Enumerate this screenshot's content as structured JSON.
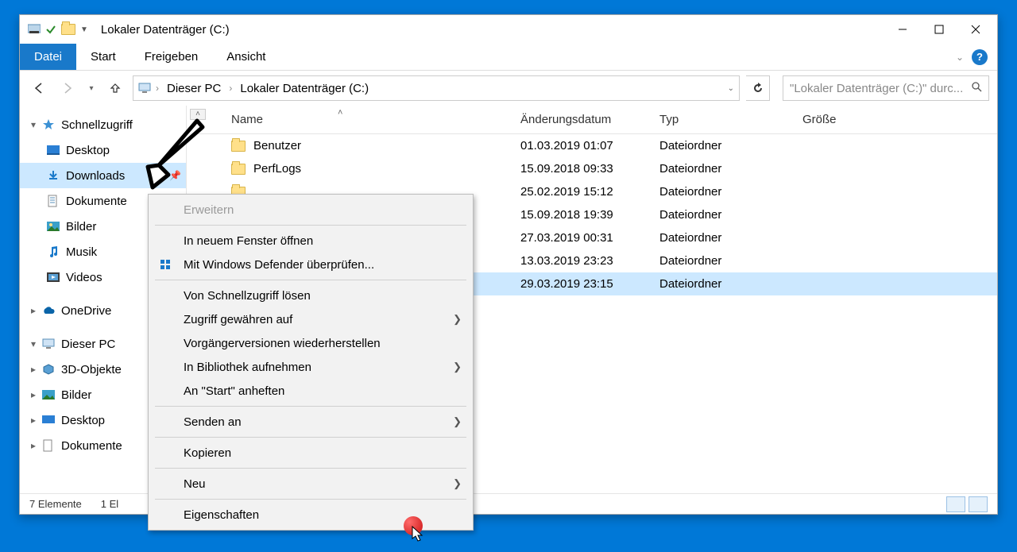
{
  "title": "Lokaler Datenträger (C:)",
  "ribbon": {
    "datei": "Datei",
    "start": "Start",
    "freigeben": "Freigeben",
    "ansicht": "Ansicht"
  },
  "breadcrumb": {
    "pc": "Dieser PC",
    "drive": "Lokaler Datenträger (C:)"
  },
  "search": {
    "placeholder": "\"Lokaler Datenträger (C:)\" durc..."
  },
  "sidebar": {
    "quick": "Schnellzugriff",
    "desktop": "Desktop",
    "downloads": "Downloads",
    "dokumente": "Dokumente",
    "bilder": "Bilder",
    "musik": "Musik",
    "videos": "Videos",
    "onedrive": "OneDrive",
    "thispc": "Dieser PC",
    "objects3d": "3D-Objekte",
    "bilder2": "Bilder",
    "desktop2": "Desktop",
    "dokumente2": "Dokumente"
  },
  "columns": {
    "name": "Name",
    "date": "Änderungsdatum",
    "type": "Typ",
    "size": "Größe"
  },
  "rows": [
    {
      "name": "Benutzer",
      "date": "01.03.2019 01:07",
      "type": "Dateiordner"
    },
    {
      "name": "PerfLogs",
      "date": "15.09.2018 09:33",
      "type": "Dateiordner"
    },
    {
      "name": "",
      "date": "25.02.2019 15:12",
      "type": "Dateiordner"
    },
    {
      "name": "",
      "date": "15.09.2018 19:39",
      "type": "Dateiordner"
    },
    {
      "name": "",
      "date": "27.03.2019 00:31",
      "type": "Dateiordner"
    },
    {
      "name": "",
      "date": "13.03.2019 23:23",
      "type": "Dateiordner"
    },
    {
      "name": "",
      "date": "29.03.2019 23:15",
      "type": "Dateiordner"
    }
  ],
  "context": {
    "erweitern": "Erweitern",
    "neufenster": "In neuem Fenster öffnen",
    "defender": "Mit Windows Defender überprüfen...",
    "loesen": "Von Schnellzugriff lösen",
    "zugriff": "Zugriff gewähren auf",
    "vorgaenger": "Vorgängerversionen wiederherstellen",
    "bibliothek": "In Bibliothek aufnehmen",
    "anstart": "An \"Start\" anheften",
    "senden": "Senden an",
    "kopieren": "Kopieren",
    "neu": "Neu",
    "eigenschaften": "Eigenschaften"
  },
  "status": {
    "count": "7 Elemente",
    "selected": "1 El"
  }
}
